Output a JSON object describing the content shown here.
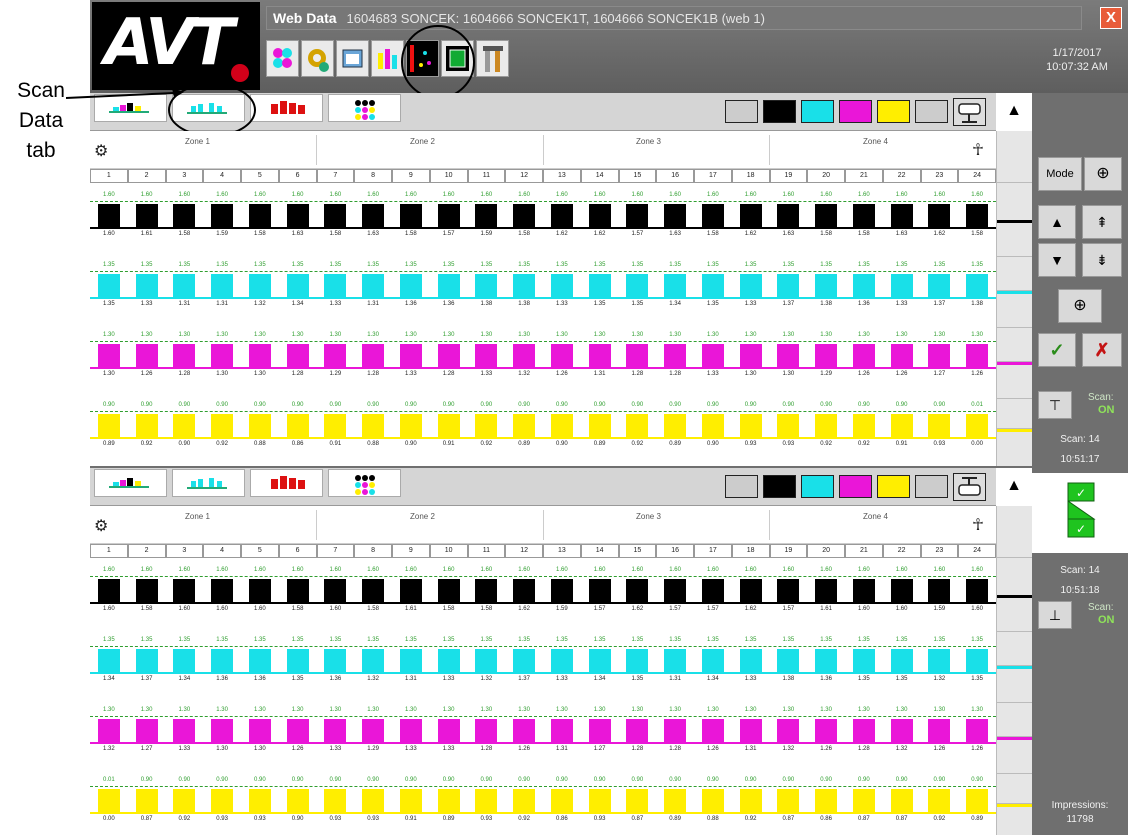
{
  "callout": {
    "line1": "Scan",
    "line2": "Data",
    "line3": "tab"
  },
  "header": {
    "app_name": "Web Data",
    "job_info": "1604683 SONCEK: 1604666 SONCEK1T, 1604666 SONCEK1B (web 1)",
    "close_glyph": "X",
    "date": "1/17/2017",
    "time": "10:07:32 AM",
    "logo_text": "AVT",
    "toolbar_icons": [
      "ink-keys-icon",
      "settings-gears-icon",
      "window-icon",
      "scan-data-icon",
      "color-map-icon",
      "frame-icon",
      "tools-icon"
    ]
  },
  "zones": [
    "Zone 1",
    "Zone 2",
    "Zone 3",
    "Zone 4"
  ],
  "columns": [
    "1",
    "2",
    "3",
    "4",
    "5",
    "6",
    "7",
    "8",
    "9",
    "10",
    "11",
    "12",
    "13",
    "14",
    "15",
    "16",
    "17",
    "18",
    "19",
    "20",
    "21",
    "22",
    "23",
    "24"
  ],
  "colors": {
    "black": "#000000",
    "cyan": "#19e0e8",
    "magenta": "#ea16d8",
    "yellow": "#ffee00",
    "target": "#2f9e2f"
  },
  "panes": [
    {
      "strips": [
        {
          "color": "black",
          "targets": [
            "1.60",
            "1.60",
            "1.60",
            "1.60",
            "1.60",
            "1.60",
            "1.60",
            "1.60",
            "1.60",
            "1.60",
            "1.60",
            "1.60",
            "1.60",
            "1.60",
            "1.60",
            "1.60",
            "1.60",
            "1.60",
            "1.60",
            "1.60",
            "1.60",
            "1.60",
            "1.60",
            "1.60"
          ],
          "values": [
            "1.60",
            "1.61",
            "1.58",
            "1.59",
            "1.58",
            "1.63",
            "1.58",
            "1.63",
            "1.58",
            "1.57",
            "1.59",
            "1.58",
            "1.62",
            "1.62",
            "1.57",
            "1.63",
            "1.58",
            "1.62",
            "1.63",
            "1.58",
            "1.58",
            "1.63",
            "1.62",
            "1.58"
          ]
        },
        {
          "color": "cyan",
          "targets": [
            "1.35",
            "1.35",
            "1.35",
            "1.35",
            "1.35",
            "1.35",
            "1.35",
            "1.35",
            "1.35",
            "1.35",
            "1.35",
            "1.35",
            "1.35",
            "1.35",
            "1.35",
            "1.35",
            "1.35",
            "1.35",
            "1.35",
            "1.35",
            "1.35",
            "1.35",
            "1.35",
            "1.35"
          ],
          "values": [
            "1.35",
            "1.33",
            "1.31",
            "1.31",
            "1.32",
            "1.34",
            "1.33",
            "1.31",
            "1.36",
            "1.36",
            "1.38",
            "1.38",
            "1.33",
            "1.35",
            "1.35",
            "1.34",
            "1.35",
            "1.33",
            "1.37",
            "1.38",
            "1.36",
            "1.33",
            "1.37",
            "1.38"
          ]
        },
        {
          "color": "magenta",
          "targets": [
            "1.30",
            "1.30",
            "1.30",
            "1.30",
            "1.30",
            "1.30",
            "1.30",
            "1.30",
            "1.30",
            "1.30",
            "1.30",
            "1.30",
            "1.30",
            "1.30",
            "1.30",
            "1.30",
            "1.30",
            "1.30",
            "1.30",
            "1.30",
            "1.30",
            "1.30",
            "1.30",
            "1.30"
          ],
          "values": [
            "1.30",
            "1.26",
            "1.28",
            "1.30",
            "1.30",
            "1.28",
            "1.29",
            "1.28",
            "1.33",
            "1.28",
            "1.33",
            "1.32",
            "1.26",
            "1.31",
            "1.28",
            "1.28",
            "1.33",
            "1.30",
            "1.30",
            "1.29",
            "1.26",
            "1.26",
            "1.27",
            "1.26"
          ]
        },
        {
          "color": "yellow",
          "targets": [
            "0.90",
            "0.90",
            "0.90",
            "0.90",
            "0.90",
            "0.90",
            "0.90",
            "0.90",
            "0.90",
            "0.90",
            "0.90",
            "0.90",
            "0.90",
            "0.90",
            "0.90",
            "0.90",
            "0.90",
            "0.90",
            "0.90",
            "0.90",
            "0.90",
            "0.90",
            "0.90",
            "0.01"
          ],
          "values": [
            "0.89",
            "0.92",
            "0.90",
            "0.92",
            "0.88",
            "0.86",
            "0.91",
            "0.88",
            "0.90",
            "0.91",
            "0.92",
            "0.89",
            "0.90",
            "0.89",
            "0.92",
            "0.89",
            "0.90",
            "0.93",
            "0.93",
            "0.92",
            "0.92",
            "0.91",
            "0.93",
            "0.00"
          ]
        }
      ]
    },
    {
      "strips": [
        {
          "color": "black",
          "targets": [
            "1.60",
            "1.60",
            "1.60",
            "1.60",
            "1.60",
            "1.60",
            "1.60",
            "1.60",
            "1.60",
            "1.60",
            "1.60",
            "1.60",
            "1.60",
            "1.60",
            "1.60",
            "1.60",
            "1.60",
            "1.60",
            "1.60",
            "1.60",
            "1.60",
            "1.60",
            "1.60",
            "1.60"
          ],
          "values": [
            "1.60",
            "1.58",
            "1.60",
            "1.60",
            "1.60",
            "1.58",
            "1.60",
            "1.58",
            "1.61",
            "1.58",
            "1.58",
            "1.62",
            "1.59",
            "1.57",
            "1.62",
            "1.57",
            "1.57",
            "1.62",
            "1.57",
            "1.61",
            "1.60",
            "1.60",
            "1.59",
            "1.60"
          ]
        },
        {
          "color": "cyan",
          "targets": [
            "1.35",
            "1.35",
            "1.35",
            "1.35",
            "1.35",
            "1.35",
            "1.35",
            "1.35",
            "1.35",
            "1.35",
            "1.35",
            "1.35",
            "1.35",
            "1.35",
            "1.35",
            "1.35",
            "1.35",
            "1.35",
            "1.35",
            "1.35",
            "1.35",
            "1.35",
            "1.35",
            "1.35"
          ],
          "values": [
            "1.34",
            "1.37",
            "1.34",
            "1.36",
            "1.36",
            "1.35",
            "1.36",
            "1.32",
            "1.31",
            "1.33",
            "1.32",
            "1.37",
            "1.33",
            "1.34",
            "1.35",
            "1.31",
            "1.34",
            "1.33",
            "1.38",
            "1.36",
            "1.35",
            "1.35",
            "1.32",
            "1.35"
          ]
        },
        {
          "color": "magenta",
          "targets": [
            "1.30",
            "1.30",
            "1.30",
            "1.30",
            "1.30",
            "1.30",
            "1.30",
            "1.30",
            "1.30",
            "1.30",
            "1.30",
            "1.30",
            "1.30",
            "1.30",
            "1.30",
            "1.30",
            "1.30",
            "1.30",
            "1.30",
            "1.30",
            "1.30",
            "1.30",
            "1.30",
            "1.30"
          ],
          "values": [
            "1.32",
            "1.27",
            "1.33",
            "1.30",
            "1.30",
            "1.26",
            "1.33",
            "1.29",
            "1.33",
            "1.33",
            "1.28",
            "1.26",
            "1.31",
            "1.27",
            "1.28",
            "1.28",
            "1.26",
            "1.31",
            "1.32",
            "1.26",
            "1.28",
            "1.32",
            "1.26",
            "1.26"
          ]
        },
        {
          "color": "yellow",
          "targets": [
            "0.01",
            "0.90",
            "0.90",
            "0.90",
            "0.90",
            "0.90",
            "0.90",
            "0.90",
            "0.90",
            "0.90",
            "0.90",
            "0.90",
            "0.90",
            "0.90",
            "0.90",
            "0.90",
            "0.90",
            "0.90",
            "0.90",
            "0.90",
            "0.90",
            "0.90",
            "0.90",
            "0.90"
          ],
          "values": [
            "0.00",
            "0.87",
            "0.92",
            "0.93",
            "0.93",
            "0.90",
            "0.93",
            "0.93",
            "0.91",
            "0.89",
            "0.93",
            "0.92",
            "0.86",
            "0.93",
            "0.87",
            "0.89",
            "0.88",
            "0.92",
            "0.87",
            "0.86",
            "0.87",
            "0.87",
            "0.92",
            "0.89"
          ]
        }
      ]
    }
  ],
  "sidebar": {
    "mode_label": "Mode",
    "scan_label": "Scan:",
    "scan_state": "ON",
    "scan1_label": "Scan: 14",
    "scan1_time": "10:51:17",
    "scan2_label": "Scan: 14",
    "scan2_time": "10:51:18",
    "scan2_label_text": "Scan:",
    "scan2_state": "ON",
    "impressions_label": "Impressions:",
    "impressions_value": "11798"
  }
}
